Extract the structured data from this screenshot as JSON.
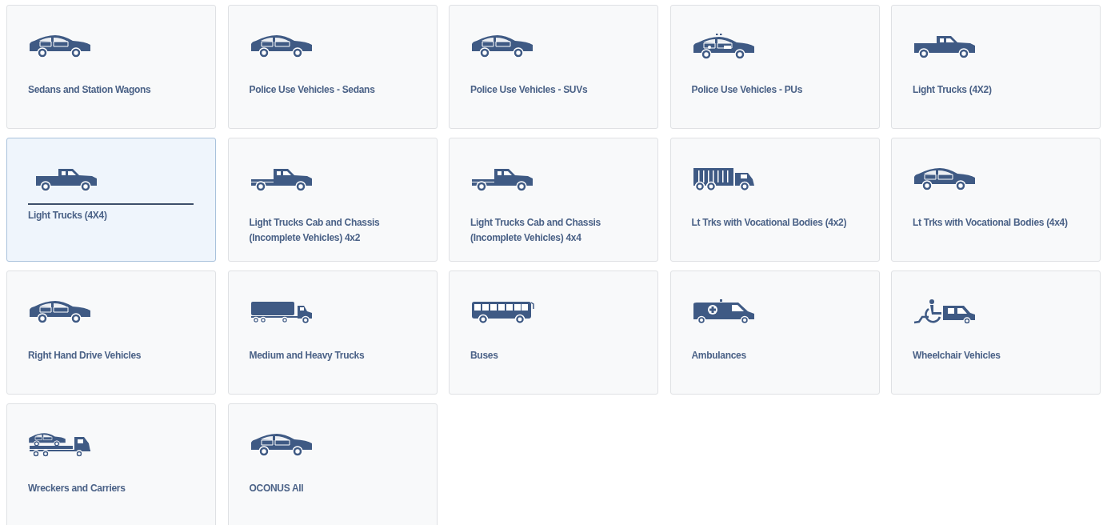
{
  "cards": [
    {
      "label": "Sedans and Station Wagons",
      "kind": "sedan",
      "selected": false
    },
    {
      "label": "Police Use Vehicles - Sedans",
      "kind": "sedan",
      "selected": false
    },
    {
      "label": "Police Use Vehicles - SUVs",
      "kind": "sedan",
      "selected": false
    },
    {
      "label": "Police Use Vehicles - PUs",
      "kind": "police",
      "selected": false
    },
    {
      "label": "Light Trucks (4X2)",
      "kind": "pickup",
      "selected": false
    },
    {
      "label": "Light Trucks (4X4)",
      "kind": "pickup",
      "selected": true
    },
    {
      "label": "Light Trucks Cab and Chassis (Incomplete Vehicles) 4x2",
      "kind": "chassis",
      "selected": false
    },
    {
      "label": "Light Trucks Cab and Chassis (Incomplete Vehicles) 4x4",
      "kind": "chassis",
      "selected": false
    },
    {
      "label": "Lt Trks with Vocational Bodies (4x2)",
      "kind": "boxtruck",
      "selected": false
    },
    {
      "label": "Lt Trks with Vocational Bodies (4x4)",
      "kind": "sedan",
      "selected": false
    },
    {
      "label": "Right Hand Drive Vehicles",
      "kind": "sedan",
      "selected": false
    },
    {
      "label": "Medium and Heavy Trucks",
      "kind": "semi",
      "selected": false
    },
    {
      "label": "Buses",
      "kind": "bus",
      "selected": false
    },
    {
      "label": "Ambulances",
      "kind": "ambulance",
      "selected": false
    },
    {
      "label": "Wheelchair Vehicles",
      "kind": "wheelchair",
      "selected": false
    },
    {
      "label": "Wreckers and Carriers",
      "kind": "wrecker",
      "selected": false
    },
    {
      "label": "OCONUS All",
      "kind": "sedan",
      "selected": false
    }
  ]
}
